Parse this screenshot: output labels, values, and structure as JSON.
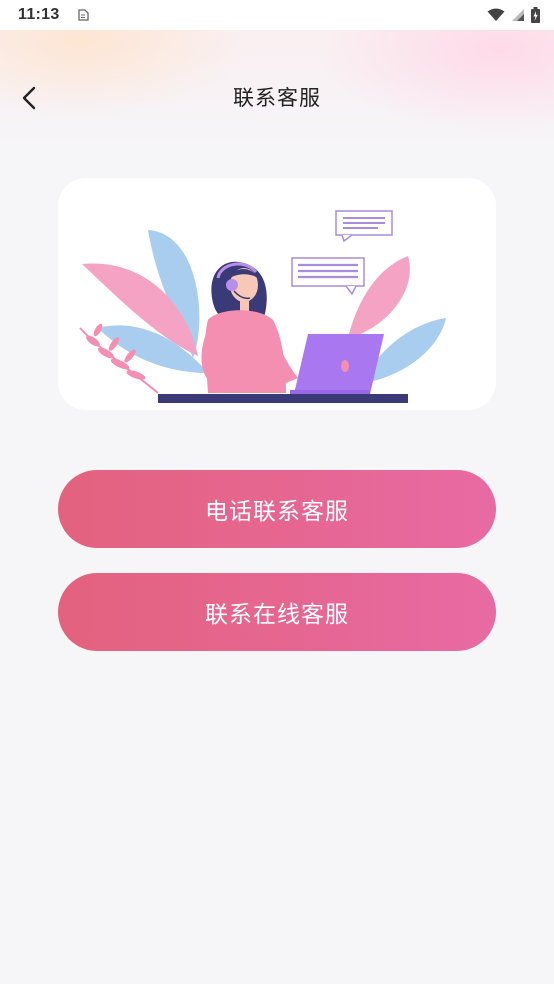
{
  "status_bar": {
    "time": "11:13",
    "icons": [
      "notification-icon",
      "wifi-icon",
      "signal-icon",
      "battery-icon"
    ]
  },
  "nav": {
    "back_icon": "chevron-left-icon",
    "title": "联系客服"
  },
  "illustration": {
    "description_icon": "customer-service-illustration"
  },
  "buttons": {
    "phone_label": "电话联系客服",
    "online_label": "联系在线客服"
  },
  "colors": {
    "button_gradient_start": "#e3627e",
    "button_gradient_end": "#e86aa3",
    "background": "#f6f5f8",
    "card": "#ffffff"
  }
}
